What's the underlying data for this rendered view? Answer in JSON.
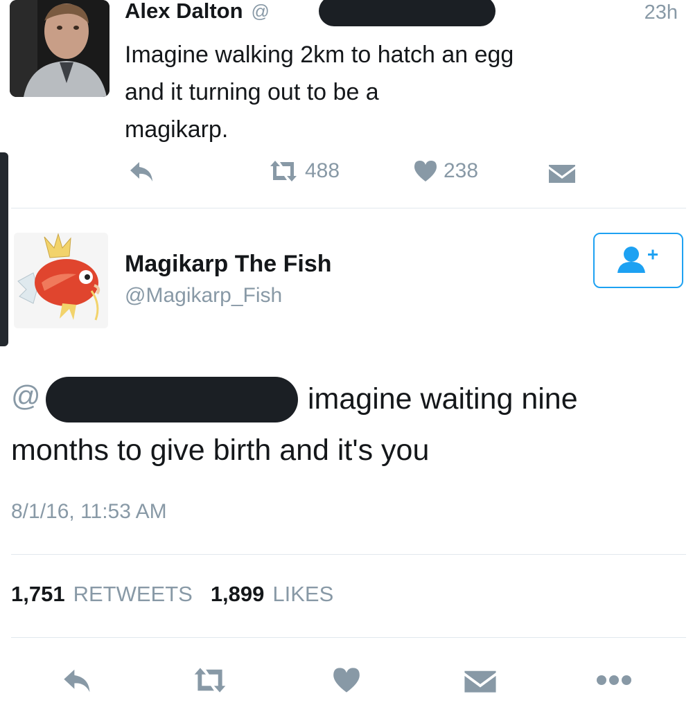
{
  "first_tweet": {
    "author_name": "Alex Dalton",
    "handle_prefix": "@",
    "time_ago": "23h",
    "text_lines": [
      "Imagine walking 2km to hatch an egg",
      "and it turning out to be a",
      "magikarp."
    ],
    "retweet_count": "488",
    "like_count": "238",
    "colors": {
      "action_gray": "#8899a6",
      "text": "#14171a"
    },
    "icons": [
      "reply-icon",
      "retweet-icon",
      "like-icon",
      "dm-icon"
    ]
  },
  "reply_tweet": {
    "author_name": "Magikarp The Fish",
    "author_handle": "@Magikarp_Fish",
    "mention_prefix": "@",
    "text_line1": "imagine waiting nine",
    "text_line2": "months to give birth and it's you",
    "timestamp": "8/1/16, 11:53 AM",
    "retweets_count": "1,751",
    "retweets_label": "RETWEETS",
    "likes_count": "1,899",
    "likes_label": "LIKES",
    "icons": [
      "reply-icon",
      "retweet-icon",
      "like-icon",
      "dm-icon",
      "more-icon",
      "follow-user-icon"
    ],
    "colors": {
      "follow_border": "#1da1f2",
      "follow_icon": "#1da1f2",
      "action_gray": "#8899a6"
    }
  }
}
